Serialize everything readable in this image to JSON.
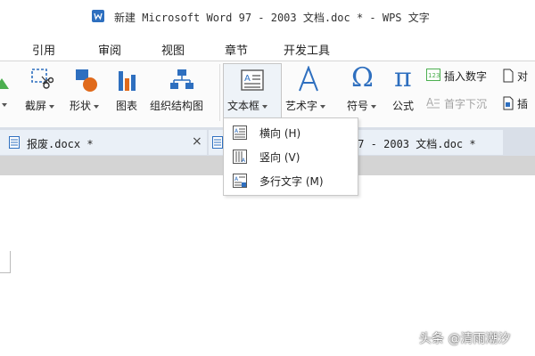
{
  "window": {
    "title": "新建 Microsoft Word 97 - 2003 文档.doc * - WPS 文字"
  },
  "menu": [
    "引用",
    "审阅",
    "视图",
    "章节",
    "开发工具"
  ],
  "ribbon": {
    "screenshot_label": "截屏",
    "shape_label": "形状",
    "chart_label": "图表",
    "orgchart_label": "组织结构图",
    "textbox_label": "文本框",
    "wordart_label": "艺术字",
    "symbol_label": "符号",
    "formula_label": "公式",
    "insert_number_label": "插入数字",
    "dropcap_label": "首字下沉",
    "cut_off_1": "对",
    "cut_off_2": "插"
  },
  "tabs": {
    "tab1_label": "报废.docx *",
    "tab2_label": "97 - 2003 文档.doc *",
    "close_glyph": "×"
  },
  "dropdown": {
    "items": [
      "横向 (H)",
      "竖向 (V)",
      "多行文字 (M)"
    ]
  },
  "watermark": "头条 @清雨潮汐",
  "colors": {
    "accent_blue": "#2e6fbf",
    "orange": "#e06a1b",
    "tab_bar": "#d9dfe8"
  }
}
